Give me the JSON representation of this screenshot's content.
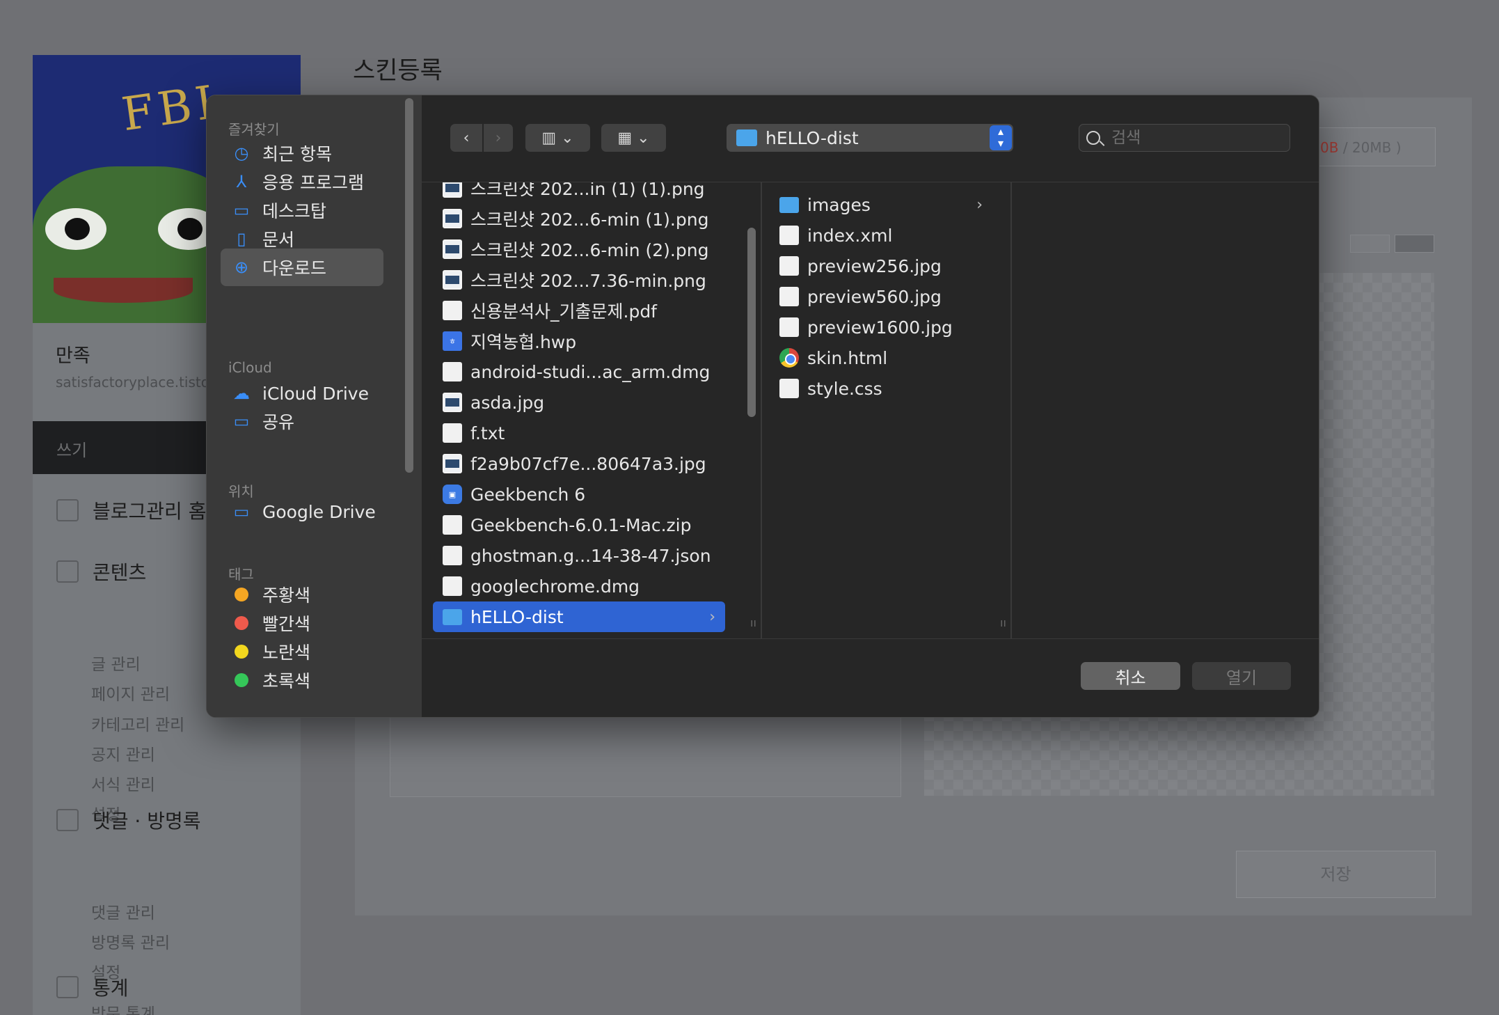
{
  "background": {
    "title": "스킨등록",
    "blog_name": "만족",
    "blog_url": "satisfactoryplace.tisto",
    "write_label": "쓰기",
    "menu": [
      {
        "label": "블로그관리 홈",
        "icon": "home-icon"
      },
      {
        "label": "콘텐츠",
        "icon": "document-icon",
        "items": [
          "글 관리",
          "페이지 관리",
          "카테고리 관리",
          "공지 관리",
          "서식 관리",
          "설정"
        ]
      },
      {
        "label": "댓글 · 방명록",
        "icon": "comment-icon",
        "items": [
          "댓글 관리",
          "방명록 관리",
          "설정"
        ]
      },
      {
        "label": "통계",
        "icon": "bar-chart-icon",
        "items": [
          "방문 통계"
        ]
      }
    ],
    "size_used": "0B",
    "size_limit": "/ 20MB )",
    "save_label": "저장"
  },
  "dialog": {
    "sections": {
      "favorites": "즐겨찾기",
      "icloud": "iCloud",
      "locations": "위치",
      "tags": "태그"
    },
    "favorites": [
      {
        "label": "최근 항목",
        "icon": "clock-icon"
      },
      {
        "label": "응용 프로그램",
        "icon": "applications-icon"
      },
      {
        "label": "데스크탑",
        "icon": "desktop-icon"
      },
      {
        "label": "문서",
        "icon": "document-icon"
      },
      {
        "label": "다운로드",
        "icon": "download-icon",
        "selected": true
      }
    ],
    "icloud": [
      {
        "label": "iCloud Drive",
        "icon": "cloud-icon"
      },
      {
        "label": "공유",
        "icon": "shared-folder-icon"
      }
    ],
    "locations": [
      {
        "label": "Google Drive",
        "icon": "folder-icon"
      }
    ],
    "tags": [
      {
        "label": "주황색",
        "color": "#f5a623"
      },
      {
        "label": "빨간색",
        "color": "#ef5a4c"
      },
      {
        "label": "노란색",
        "color": "#f2d71e"
      },
      {
        "label": "초록색",
        "color": "#35c759"
      }
    ],
    "path": "hELLO-dist",
    "search_placeholder": "검색",
    "column1": [
      {
        "name": "스크린샷 202...in (1) (1).png",
        "type": "img"
      },
      {
        "name": "스크린샷 202...6-min (1).png",
        "type": "img"
      },
      {
        "name": "스크린샷 202...6-min (2).png",
        "type": "img"
      },
      {
        "name": "스크린샷 202...7.36-min.png",
        "type": "img"
      },
      {
        "name": "신용분석사_기출문제.pdf",
        "type": "doc"
      },
      {
        "name": "지역농협.hwp",
        "type": "hwp"
      },
      {
        "name": "android-studi...ac_arm.dmg",
        "type": "doc"
      },
      {
        "name": "asda.jpg",
        "type": "img"
      },
      {
        "name": "f.txt",
        "type": "doc"
      },
      {
        "name": "f2a9b07cf7e...80647a3.jpg",
        "type": "img"
      },
      {
        "name": "Geekbench 6",
        "type": "app"
      },
      {
        "name": "Geekbench-6.0.1-Mac.zip",
        "type": "doc"
      },
      {
        "name": "ghostman.g...14-38-47.json",
        "type": "doc"
      },
      {
        "name": "googlechrome.dmg",
        "type": "doc"
      },
      {
        "name": "hELLO-dist",
        "type": "folder",
        "selected": true
      }
    ],
    "column2": [
      {
        "name": "images",
        "type": "folder",
        "chevron": true
      },
      {
        "name": "index.xml",
        "type": "doc"
      },
      {
        "name": "preview256.jpg",
        "type": "doc"
      },
      {
        "name": "preview560.jpg",
        "type": "doc"
      },
      {
        "name": "preview1600.jpg",
        "type": "doc"
      },
      {
        "name": "skin.html",
        "type": "chrome"
      },
      {
        "name": "style.css",
        "type": "doc"
      }
    ],
    "cancel_label": "취소",
    "open_label": "열기"
  }
}
